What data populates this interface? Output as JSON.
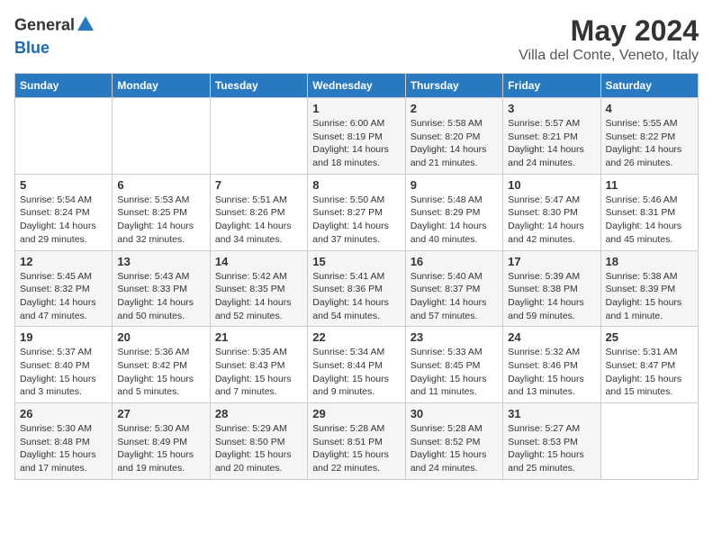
{
  "header": {
    "logo_general": "General",
    "logo_blue": "Blue",
    "month_year": "May 2024",
    "location": "Villa del Conte, Veneto, Italy"
  },
  "calendar": {
    "days_of_week": [
      "Sunday",
      "Monday",
      "Tuesday",
      "Wednesday",
      "Thursday",
      "Friday",
      "Saturday"
    ],
    "weeks": [
      [
        {
          "day": "",
          "info": ""
        },
        {
          "day": "",
          "info": ""
        },
        {
          "day": "",
          "info": ""
        },
        {
          "day": "1",
          "info": "Sunrise: 6:00 AM\nSunset: 8:19 PM\nDaylight: 14 hours and 18 minutes."
        },
        {
          "day": "2",
          "info": "Sunrise: 5:58 AM\nSunset: 8:20 PM\nDaylight: 14 hours and 21 minutes."
        },
        {
          "day": "3",
          "info": "Sunrise: 5:57 AM\nSunset: 8:21 PM\nDaylight: 14 hours and 24 minutes."
        },
        {
          "day": "4",
          "info": "Sunrise: 5:55 AM\nSunset: 8:22 PM\nDaylight: 14 hours and 26 minutes."
        }
      ],
      [
        {
          "day": "5",
          "info": "Sunrise: 5:54 AM\nSunset: 8:24 PM\nDaylight: 14 hours and 29 minutes."
        },
        {
          "day": "6",
          "info": "Sunrise: 5:53 AM\nSunset: 8:25 PM\nDaylight: 14 hours and 32 minutes."
        },
        {
          "day": "7",
          "info": "Sunrise: 5:51 AM\nSunset: 8:26 PM\nDaylight: 14 hours and 34 minutes."
        },
        {
          "day": "8",
          "info": "Sunrise: 5:50 AM\nSunset: 8:27 PM\nDaylight: 14 hours and 37 minutes."
        },
        {
          "day": "9",
          "info": "Sunrise: 5:48 AM\nSunset: 8:29 PM\nDaylight: 14 hours and 40 minutes."
        },
        {
          "day": "10",
          "info": "Sunrise: 5:47 AM\nSunset: 8:30 PM\nDaylight: 14 hours and 42 minutes."
        },
        {
          "day": "11",
          "info": "Sunrise: 5:46 AM\nSunset: 8:31 PM\nDaylight: 14 hours and 45 minutes."
        }
      ],
      [
        {
          "day": "12",
          "info": "Sunrise: 5:45 AM\nSunset: 8:32 PM\nDaylight: 14 hours and 47 minutes."
        },
        {
          "day": "13",
          "info": "Sunrise: 5:43 AM\nSunset: 8:33 PM\nDaylight: 14 hours and 50 minutes."
        },
        {
          "day": "14",
          "info": "Sunrise: 5:42 AM\nSunset: 8:35 PM\nDaylight: 14 hours and 52 minutes."
        },
        {
          "day": "15",
          "info": "Sunrise: 5:41 AM\nSunset: 8:36 PM\nDaylight: 14 hours and 54 minutes."
        },
        {
          "day": "16",
          "info": "Sunrise: 5:40 AM\nSunset: 8:37 PM\nDaylight: 14 hours and 57 minutes."
        },
        {
          "day": "17",
          "info": "Sunrise: 5:39 AM\nSunset: 8:38 PM\nDaylight: 14 hours and 59 minutes."
        },
        {
          "day": "18",
          "info": "Sunrise: 5:38 AM\nSunset: 8:39 PM\nDaylight: 15 hours and 1 minute."
        }
      ],
      [
        {
          "day": "19",
          "info": "Sunrise: 5:37 AM\nSunset: 8:40 PM\nDaylight: 15 hours and 3 minutes."
        },
        {
          "day": "20",
          "info": "Sunrise: 5:36 AM\nSunset: 8:42 PM\nDaylight: 15 hours and 5 minutes."
        },
        {
          "day": "21",
          "info": "Sunrise: 5:35 AM\nSunset: 8:43 PM\nDaylight: 15 hours and 7 minutes."
        },
        {
          "day": "22",
          "info": "Sunrise: 5:34 AM\nSunset: 8:44 PM\nDaylight: 15 hours and 9 minutes."
        },
        {
          "day": "23",
          "info": "Sunrise: 5:33 AM\nSunset: 8:45 PM\nDaylight: 15 hours and 11 minutes."
        },
        {
          "day": "24",
          "info": "Sunrise: 5:32 AM\nSunset: 8:46 PM\nDaylight: 15 hours and 13 minutes."
        },
        {
          "day": "25",
          "info": "Sunrise: 5:31 AM\nSunset: 8:47 PM\nDaylight: 15 hours and 15 minutes."
        }
      ],
      [
        {
          "day": "26",
          "info": "Sunrise: 5:30 AM\nSunset: 8:48 PM\nDaylight: 15 hours and 17 minutes."
        },
        {
          "day": "27",
          "info": "Sunrise: 5:30 AM\nSunset: 8:49 PM\nDaylight: 15 hours and 19 minutes."
        },
        {
          "day": "28",
          "info": "Sunrise: 5:29 AM\nSunset: 8:50 PM\nDaylight: 15 hours and 20 minutes."
        },
        {
          "day": "29",
          "info": "Sunrise: 5:28 AM\nSunset: 8:51 PM\nDaylight: 15 hours and 22 minutes."
        },
        {
          "day": "30",
          "info": "Sunrise: 5:28 AM\nSunset: 8:52 PM\nDaylight: 15 hours and 24 minutes."
        },
        {
          "day": "31",
          "info": "Sunrise: 5:27 AM\nSunset: 8:53 PM\nDaylight: 15 hours and 25 minutes."
        },
        {
          "day": "",
          "info": ""
        }
      ]
    ]
  }
}
